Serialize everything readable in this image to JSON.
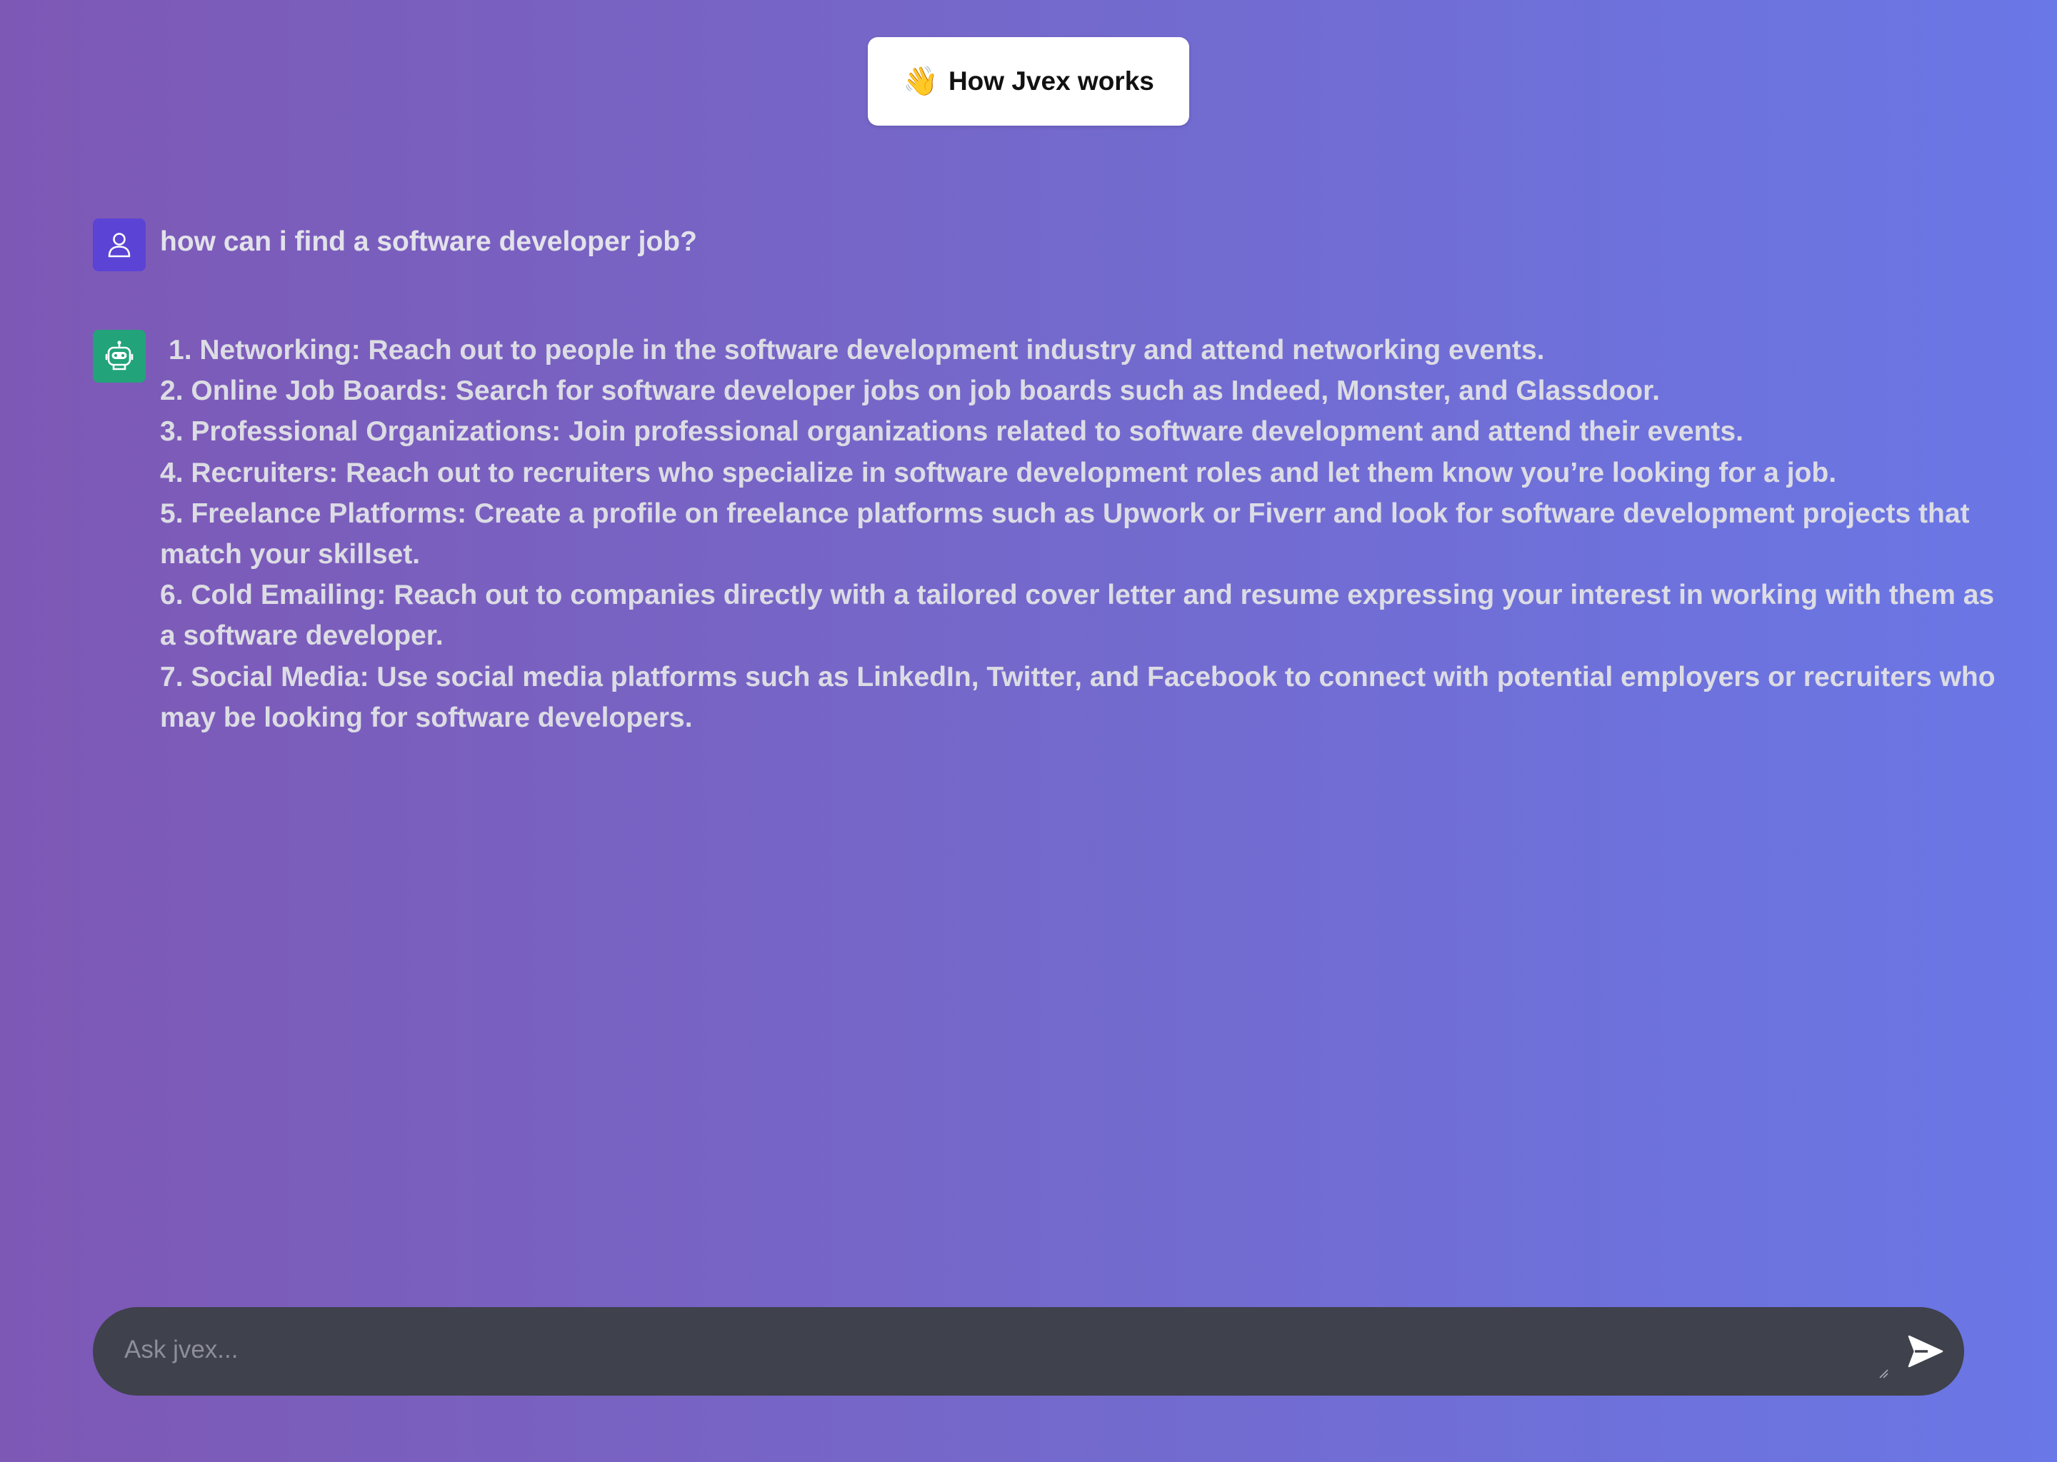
{
  "header": {
    "how_button": {
      "emoji": "👋",
      "label": "How Jvex works"
    }
  },
  "conversation": {
    "user_message": {
      "avatar_icon": "user-icon",
      "text": "how can i find a software developer job?"
    },
    "bot_message": {
      "avatar_icon": "robot-icon",
      "lines": [
        "1. Networking: Reach out to people in the software development industry and attend networking events.",
        "2. Online Job Boards: Search for software developer jobs on job boards such as Indeed, Monster, and Glassdoor.",
        "3. Professional Organizations: Join professional organizations related to software development and attend their events.",
        "4. Recruiters: Reach out to recruiters who specialize in software development roles and let them know you’re looking for a job.",
        "5. Freelance Platforms: Create a profile on freelance platforms such as Upwork or Fiverr and look for software development projects that match your skillset.",
        "6. Cold Emailing: Reach out to companies directly with a tailored cover letter and resume expressing your interest in working with them as a software developer.",
        "7. Social Media: Use social media platforms such as LinkedIn, Twitter, and Facebook to connect with potential employers or recruiters who may be looking for software developers."
      ]
    }
  },
  "composer": {
    "placeholder": "Ask jvex...",
    "value": "",
    "send_icon": "send-icon"
  },
  "colors": {
    "background_start": "#7e58b5",
    "background_end": "#6a77e6",
    "user_avatar": "#5b43d6",
    "bot_avatar": "#22a37a",
    "input_background": "#3f414c"
  }
}
